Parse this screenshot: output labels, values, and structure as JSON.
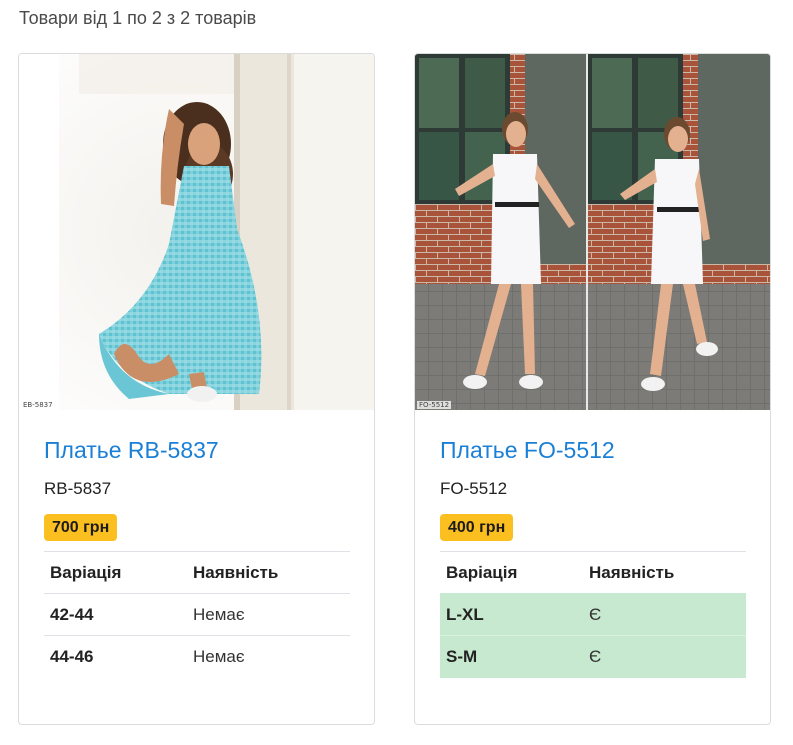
{
  "summary": "Товари від 1 по 2 з 2 товарів",
  "colors": {
    "link": "#1a7fd6",
    "price_badge": "#fbbf1f",
    "in_stock_row": "#c7e9cf"
  },
  "products": [
    {
      "image_tag": "EB-5837",
      "title": "Платье RB-5837",
      "code": "RB-5837",
      "price": "700 грн",
      "table_headers": [
        "Варіація",
        "Наявність"
      ],
      "variations": [
        {
          "size": "42-44",
          "availability": "Немає"
        },
        {
          "size": "44-46",
          "availability": "Немає"
        }
      ]
    },
    {
      "image_tag": "FO-5512",
      "title": "Платье FO-5512",
      "code": "FO-5512",
      "price": "400 грн",
      "table_headers": [
        "Варіація",
        "Наявність"
      ],
      "variations": [
        {
          "size": "L-XL",
          "availability": "Є"
        },
        {
          "size": "S-M",
          "availability": "Є"
        }
      ]
    }
  ]
}
